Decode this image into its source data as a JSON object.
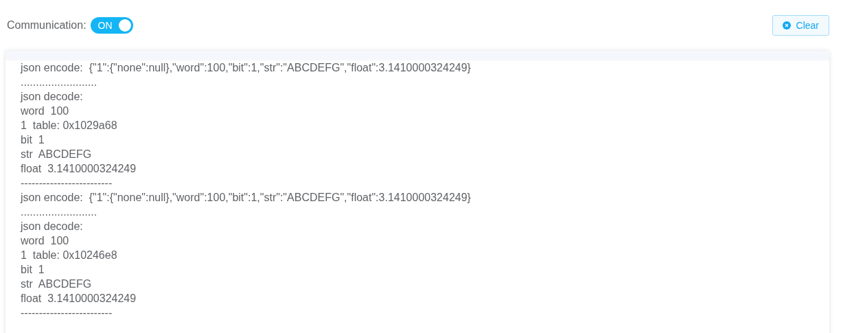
{
  "communication": {
    "label": "Communication:",
    "on": true,
    "on_text": "ON"
  },
  "clear_button": {
    "label": "Clear"
  },
  "log": {
    "lines": [
      "json encode:  {\"1\":{\"none\":null},\"word\":100,\"bit\":1,\"str\":\"ABCDEFG\",\"float\":3.1410000324249}",
      ".........................",
      "json decode:",
      "word  100",
      "1  table: 0x1029a68",
      "bit  1",
      "str  ABCDEFG",
      "float  3.1410000324249",
      "-------------------------",
      "json encode:  {\"1\":{\"none\":null},\"word\":100,\"bit\":1,\"str\":\"ABCDEFG\",\"float\":3.1410000324249}",
      ".........................",
      "json decode:",
      "word  100",
      "1  table: 0x10246e8",
      "bit  1",
      "str  ABCDEFG",
      "float  3.1410000324249",
      "-------------------------"
    ]
  }
}
